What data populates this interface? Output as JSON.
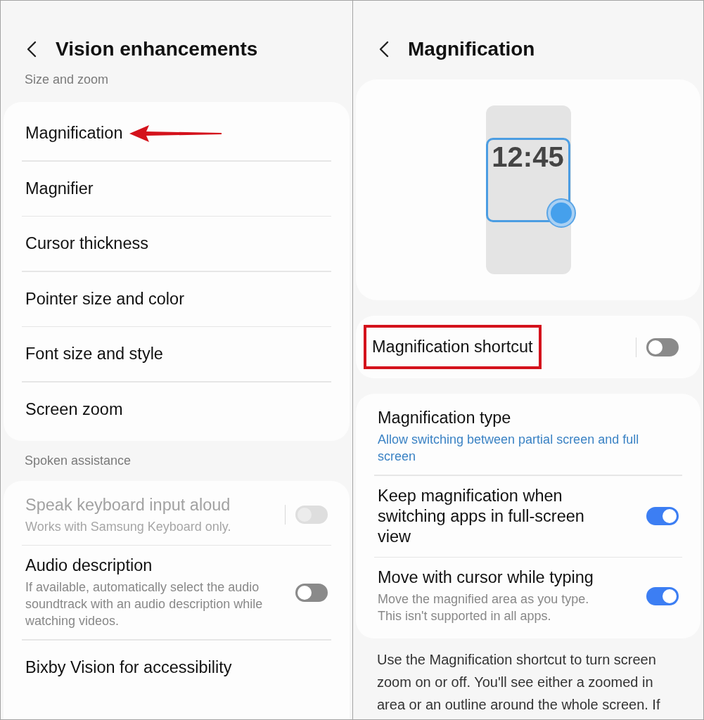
{
  "panels": [
    {
      "title": "Vision enhancements",
      "blocks": [
        {
          "kind": "section_header",
          "text": "Size and zoom"
        },
        {
          "kind": "card",
          "items": [
            {
              "kind": "link",
              "title": "Magnification",
              "disabled": false,
              "arrow_mark": true
            },
            {
              "kind": "link",
              "title": "Magnifier",
              "disabled": false,
              "arrow_mark": false
            },
            {
              "kind": "link",
              "title": "Cursor thickness",
              "disabled": false,
              "arrow_mark": false
            },
            {
              "kind": "link",
              "title": "Pointer size and color",
              "disabled": false,
              "arrow_mark": false
            },
            {
              "kind": "link",
              "title": "Font size and style",
              "disabled": false,
              "arrow_mark": false
            },
            {
              "kind": "link",
              "title": "Screen zoom",
              "disabled": false,
              "arrow_mark": false
            }
          ]
        },
        {
          "kind": "section_header",
          "text": "Spoken assistance"
        },
        {
          "kind": "card",
          "items": [
            {
              "kind": "split_toggle",
              "title": "Speak keyboard input aloud",
              "subtitle": "Works with Samsung Keyboard only.",
              "disabled": true,
              "on": false
            },
            {
              "kind": "toggle",
              "title": "Audio description",
              "subtitle": "If available, automatically select the audio soundtrack with an audio description while watching videos.",
              "disabled": false,
              "on": false
            },
            {
              "kind": "link",
              "title": "Bixby Vision for accessibility",
              "disabled": false
            }
          ]
        }
      ]
    },
    {
      "title": "Magnification",
      "blocks": [
        {
          "kind": "preview",
          "clock": "12:45"
        },
        {
          "kind": "card",
          "items": [
            {
              "kind": "split_toggle",
              "title": "Magnification shortcut",
              "disabled": false,
              "on": false,
              "box_mark": true
            }
          ]
        },
        {
          "kind": "card",
          "items": [
            {
              "kind": "link",
              "title": "Magnification type",
              "summary": "Allow switching between partial screen and full screen",
              "disabled": false
            },
            {
              "kind": "toggle",
              "title": "Keep magnification when switching apps in full-screen view",
              "disabled": false,
              "on": true
            },
            {
              "kind": "toggle",
              "title": "Move with cursor while typing",
              "subtitle": "Move the magnified area as you type. This isn't supported in all apps.",
              "disabled": false,
              "on": true
            }
          ]
        },
        {
          "kind": "note",
          "text": "Use the Magnification shortcut to turn screen zoom on or off. You'll see either a zoomed in area or an outline around the whole screen. If"
        }
      ]
    }
  ]
}
